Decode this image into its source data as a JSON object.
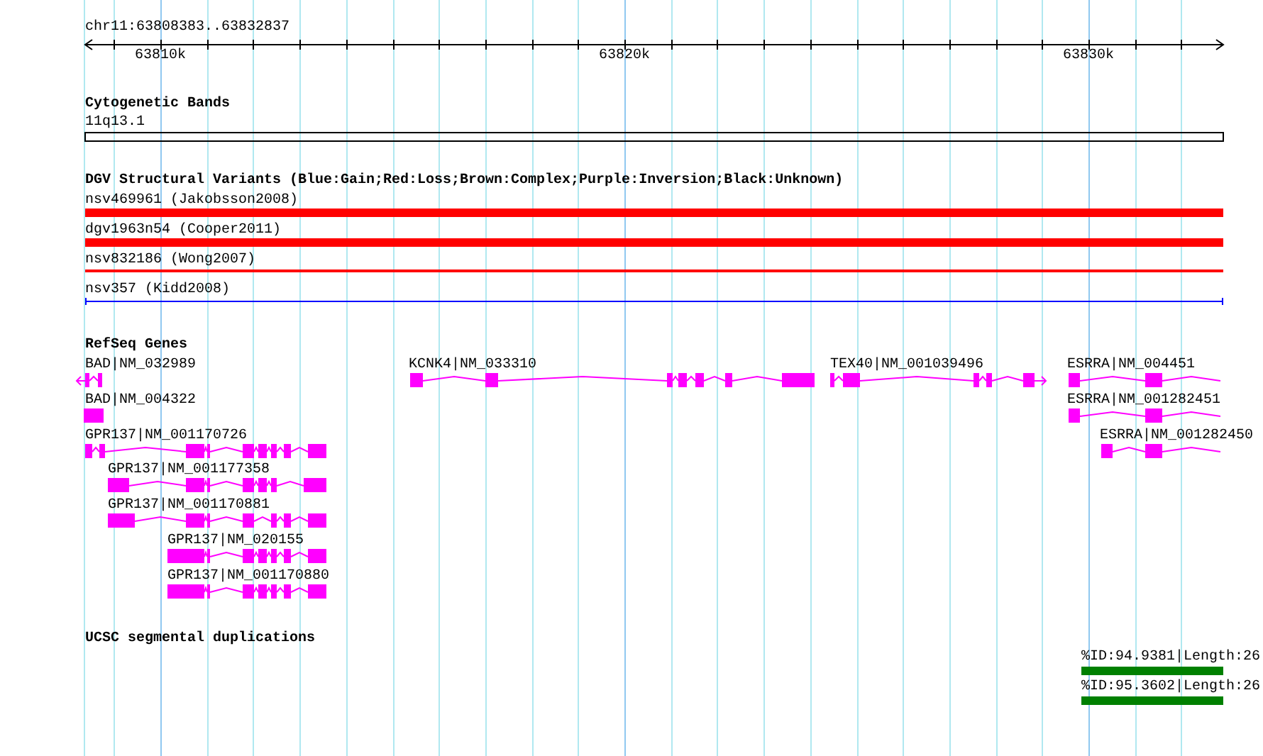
{
  "location": "chr11:63808383..63832837",
  "ruler": {
    "labels": [
      "63810k",
      "63820k",
      "63830k"
    ]
  },
  "bands": {
    "title": "Cytogenetic Bands",
    "features": [
      {
        "label": "11q13.1"
      }
    ]
  },
  "variants": {
    "title": "DGV Structural Variants (Blue:Gain;Red:Loss;Brown:Complex;Purple:Inversion;Black:Unknown)",
    "features": [
      {
        "label": "nsv469961 (Jakobsson2008)",
        "color": "#ff0000"
      },
      {
        "label": "dgv1963n54 (Cooper2011)",
        "color": "#ff0000"
      },
      {
        "label": "nsv832186 (Wong2007)",
        "color": "#ff0000"
      },
      {
        "label": "nsv357 (Kidd2008)",
        "color": "#0000ff"
      }
    ]
  },
  "genes": {
    "title": "RefSeq Genes",
    "features": [
      {
        "label": "BAD|NM_032989"
      },
      {
        "label": "KCNK4|NM_033310"
      },
      {
        "label": "TEX40|NM_001039496"
      },
      {
        "label": "ESRRA|NM_004451"
      },
      {
        "label": "BAD|NM_004322"
      },
      {
        "label": "ESRRA|NM_001282451"
      },
      {
        "label": "GPR137|NM_001170726"
      },
      {
        "label": "ESRRA|NM_001282450"
      },
      {
        "label": "GPR137|NM_001177358"
      },
      {
        "label": "GPR137|NM_001170881"
      },
      {
        "label": "GPR137|NM_020155"
      },
      {
        "label": "GPR137|NM_001170880"
      }
    ]
  },
  "segmental_duplications": {
    "title": "UCSC segmental duplications",
    "features": [
      {
        "label": "%ID:94.9381|Length:26"
      },
      {
        "label": "%ID:95.3602|Length:26"
      }
    ]
  }
}
